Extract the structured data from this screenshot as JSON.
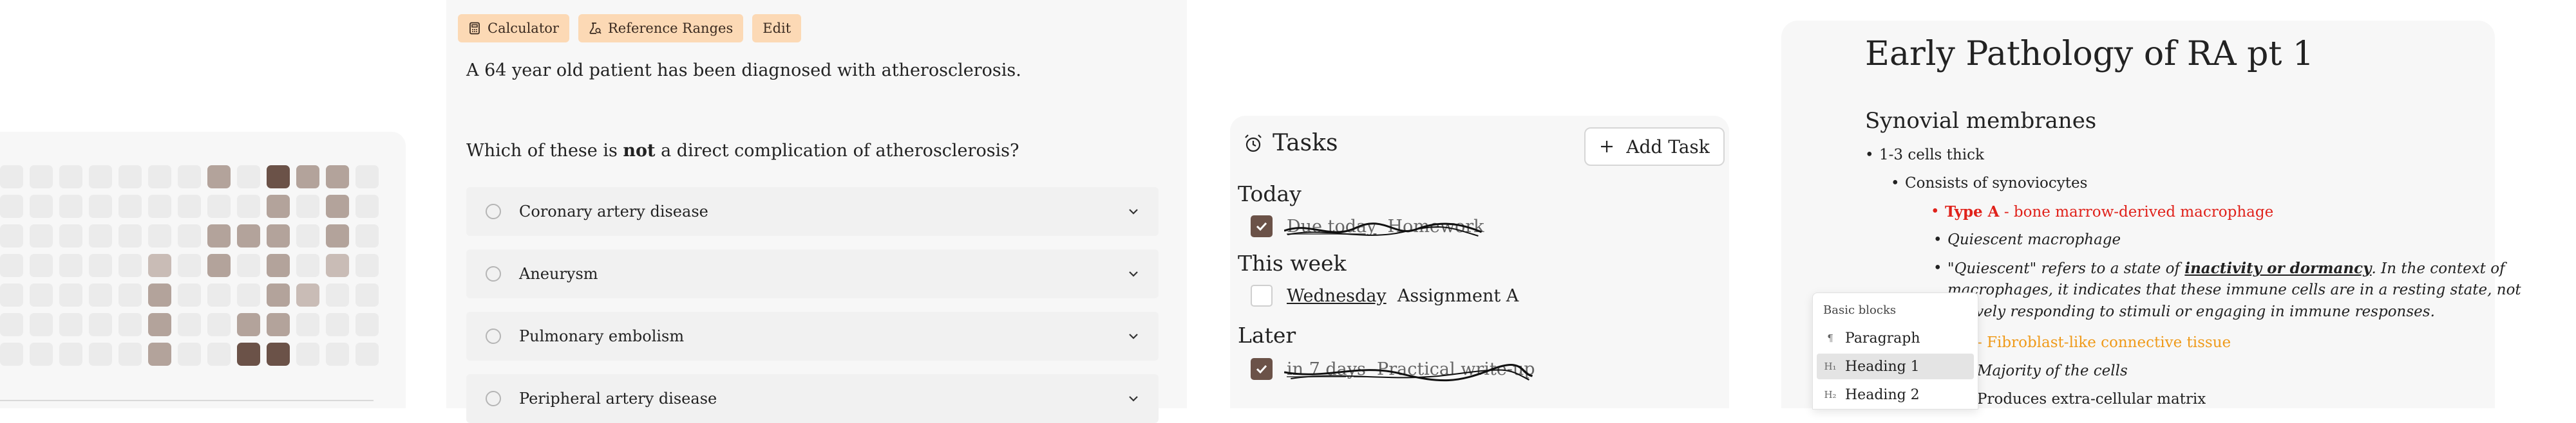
{
  "heatmap": {
    "levels": [
      [
        0,
        0,
        0,
        0,
        0,
        0,
        0,
        2,
        0,
        3,
        2,
        2,
        0
      ],
      [
        0,
        0,
        0,
        0,
        0,
        0,
        0,
        0,
        0,
        2,
        0,
        2,
        0
      ],
      [
        0,
        0,
        0,
        0,
        0,
        0,
        0,
        2,
        2,
        2,
        0,
        2,
        0
      ],
      [
        0,
        0,
        0,
        0,
        0,
        1,
        0,
        2,
        0,
        2,
        0,
        1,
        0
      ],
      [
        0,
        0,
        0,
        0,
        0,
        2,
        0,
        0,
        0,
        2,
        1,
        0,
        0
      ],
      [
        0,
        0,
        0,
        0,
        0,
        2,
        0,
        0,
        2,
        2,
        0,
        0,
        0
      ],
      [
        0,
        0,
        0,
        0,
        0,
        2,
        0,
        0,
        3,
        3,
        0,
        0,
        0
      ]
    ],
    "colors": {
      "empty": "#ebebeb",
      "low": "#c9bcb6",
      "mid": "#b3a39b",
      "high": "#6b5248"
    }
  },
  "question": {
    "toolbar": [
      {
        "label": "Calculator",
        "icon": "calculator-icon"
      },
      {
        "label": "Reference Ranges",
        "icon": "flask-icon"
      },
      {
        "label": "Edit",
        "icon": ""
      }
    ],
    "stem": "A 64 year old patient has been diagnosed with atherosclerosis.",
    "prompt_before": "Which of these is ",
    "prompt_bold": "not",
    "prompt_after": " a direct complication of atherosclerosis?",
    "options": [
      "Coronary artery disease",
      "Aneurysm",
      "Pulmonary embolism",
      "Peripheral artery disease"
    ]
  },
  "tasks": {
    "title": "Tasks",
    "add_label": "Add Task",
    "sections": [
      {
        "name": "Today",
        "items": [
          {
            "date": "Due today",
            "text": "Homework",
            "done": true
          }
        ]
      },
      {
        "name": "This week",
        "items": [
          {
            "date": "Wednesday",
            "text": "Assignment A",
            "done": false
          }
        ]
      },
      {
        "name": "Later",
        "items": [
          {
            "date": "in 7 days",
            "text": "Practical write-up",
            "done": true
          }
        ]
      }
    ]
  },
  "editor": {
    "title": "Early Pathology of RA pt 1",
    "heading": "Synovial membranes",
    "lines": {
      "l1": "1-3 cells thick",
      "l2": "Consists of synoviocytes",
      "l3_bold": "Type A",
      "l3_rest": " - bone marrow-derived macrophage",
      "l4": "Quiescent macrophage",
      "l5a": "\"Quiescent\" refers to a state of ",
      "l5b": "inactivity or dormancy",
      "l5c": ". In the context of",
      "l6": "macrophages, it indicates that these immune cells are in a resting state, not",
      "l7": "actively responding to stimuli or engaging in immune responses.",
      "l8": "- Fibroblast-like connective tissue",
      "l9": "Majority of the cells",
      "l10": "Produces extra-cellular matrix"
    },
    "colors": {
      "red": "#e0221b",
      "orange": "#ef9a1a"
    }
  },
  "slash_menu": {
    "header": "Basic blocks",
    "items": [
      {
        "glyph": "¶",
        "label": "Paragraph",
        "selected": false
      },
      {
        "glyph": "H₁",
        "label": "Heading 1",
        "selected": true
      },
      {
        "glyph": "H₂",
        "label": "Heading 2",
        "selected": false
      }
    ]
  }
}
